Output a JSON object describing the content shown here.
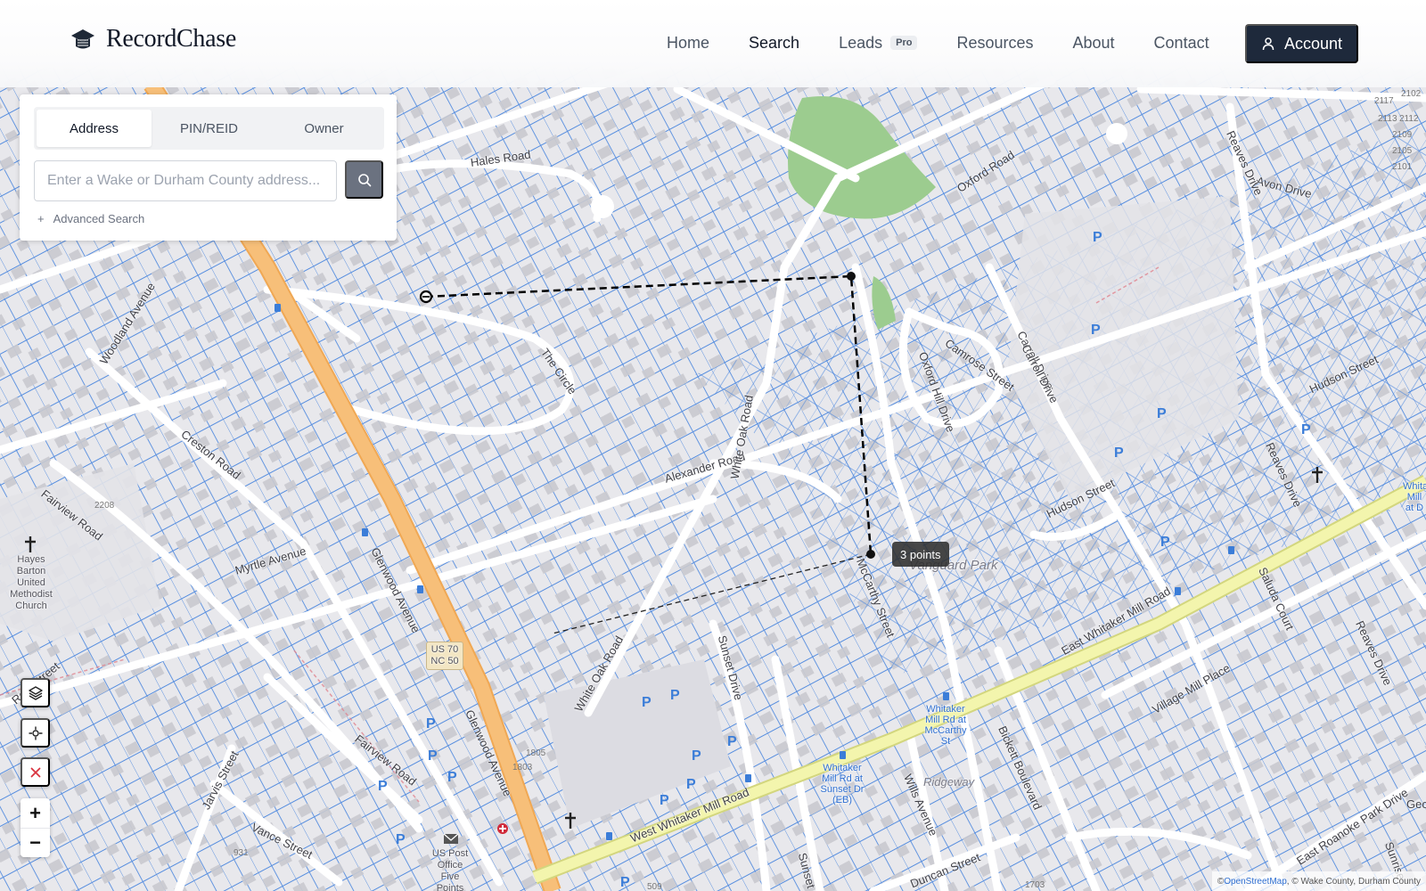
{
  "header": {
    "brand": "RecordChase",
    "nav": [
      {
        "label": "Home",
        "active": false
      },
      {
        "label": "Search",
        "active": true
      },
      {
        "label": "Leads",
        "badge": "Pro",
        "active": false
      },
      {
        "label": "Resources",
        "active": false
      },
      {
        "label": "About",
        "active": false
      },
      {
        "label": "Contact",
        "active": false
      }
    ],
    "account_label": "Account",
    "colors": {
      "account_bg": "#1e293b"
    }
  },
  "search": {
    "tabs": [
      {
        "label": "Address",
        "active": true
      },
      {
        "label": "PIN/REID",
        "active": false
      },
      {
        "label": "Owner",
        "active": false
      }
    ],
    "placeholder": "Enter a Wake or Durham County address...",
    "value": "",
    "advanced_label": "Advanced Search",
    "button_icon": "search-icon"
  },
  "map_controls": {
    "layers_icon": "layers-icon",
    "locate_icon": "crosshair-icon",
    "clear_icon": "close-icon",
    "zoom_in": "+",
    "zoom_out": "−"
  },
  "measurement": {
    "tooltip": "3 points"
  },
  "map": {
    "colors": {
      "parcel_line": "#3b7ddd",
      "highway": "#f5b86b",
      "main_road": "#f1f3a8",
      "park": "#9ccc8f",
      "measure_line": "#000000"
    },
    "streets": [
      "Hales Road",
      "Oxford Road",
      "Avon Drive",
      "Reaves Drive",
      "Woodland Avenue",
      "The Circle",
      "Camrose Street",
      "Carroll Drive",
      "Oxford Hill Drive",
      "Hudson Street",
      "Creston Road",
      "Alexander Road",
      "White Oak Road",
      "Fairview Road",
      "Myrtle Avenue",
      "Glenwood Avenue",
      "McCarthy Street",
      "Reid Street",
      "Sunset Drive",
      "East Whitaker Mill Road",
      "West Whitaker Mill Road",
      "Saluda Court",
      "Village Mill Place",
      "Bickett Boulevard",
      "Wills Avenue",
      "Jarvis Street",
      "Vance Street",
      "Duncan Street",
      "East Roanoke Park Drive",
      "Sunrise",
      "Geo"
    ],
    "areas": [
      "Vanguard Park",
      "Ridgeway"
    ],
    "pois": [
      {
        "label": "Hayes Barton United Methodist Church"
      },
      {
        "label": "US 70 NC 50"
      },
      {
        "label": "US Post Office Five Points"
      },
      {
        "label": "Whitaker Mill Rd at McCarthy St"
      },
      {
        "label": "Whitaker Mill Rd at Sunset Dr (EB)"
      },
      {
        "label": "Whita Mill at D"
      }
    ],
    "house_numbers": [
      "2208",
      "1805",
      "1803",
      "931",
      "509",
      "1703",
      "2117",
      "2112",
      "2113",
      "2109",
      "2105",
      "2101",
      "2102"
    ],
    "parking_label": "P"
  },
  "attribution": {
    "prefix": "© ",
    "link": "OpenStreetMap",
    "suffix": ", © Wake County, Durham County"
  }
}
